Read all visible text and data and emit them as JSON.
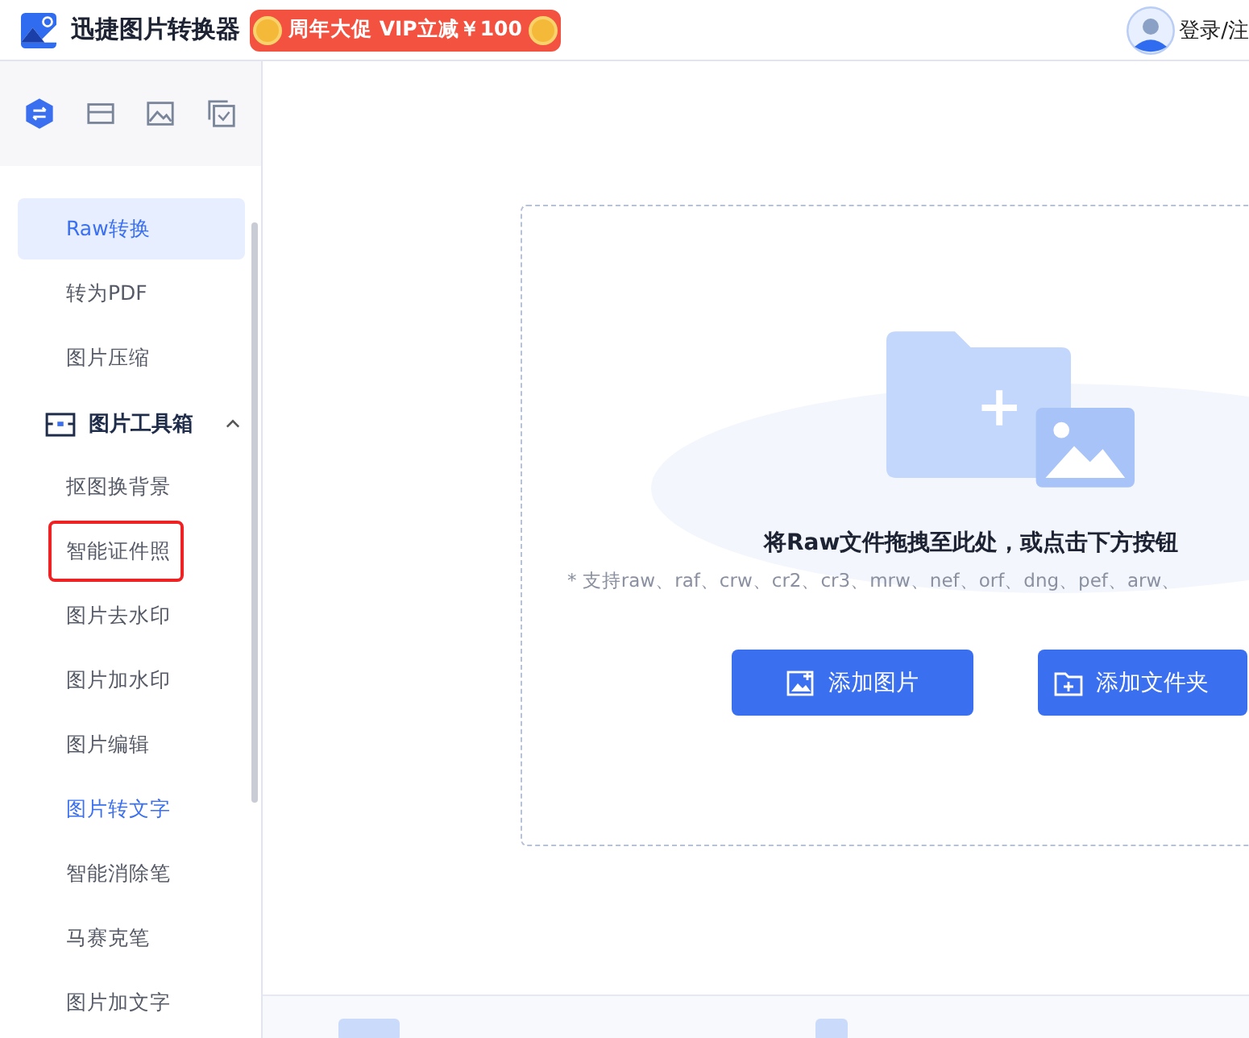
{
  "header": {
    "app_title": "迅捷图片转换器",
    "promo": "周年大促 VIP立减￥100",
    "login": "登录/注"
  },
  "sidebar": {
    "tabs": [
      {
        "selected": true
      },
      {
        "selected": false
      },
      {
        "selected": false
      },
      {
        "selected": false
      }
    ],
    "items": [
      {
        "kind": "item",
        "label": "Raw转换",
        "selected": true,
        "accent": false,
        "outlined": false
      },
      {
        "kind": "item",
        "label": "转为PDF",
        "selected": false,
        "accent": false,
        "outlined": false
      },
      {
        "kind": "item",
        "label": "图片压缩",
        "selected": false,
        "accent": false,
        "outlined": false
      },
      {
        "kind": "group",
        "label": "图片工具箱",
        "expanded": true
      },
      {
        "kind": "item",
        "label": "抠图换背景",
        "selected": false,
        "accent": false,
        "outlined": false
      },
      {
        "kind": "item",
        "label": "智能证件照",
        "selected": false,
        "accent": false,
        "outlined": true
      },
      {
        "kind": "item",
        "label": "图片去水印",
        "selected": false,
        "accent": false,
        "outlined": false
      },
      {
        "kind": "item",
        "label": "图片加水印",
        "selected": false,
        "accent": false,
        "outlined": false
      },
      {
        "kind": "item",
        "label": "图片编辑",
        "selected": false,
        "accent": false,
        "outlined": false
      },
      {
        "kind": "item",
        "label": "图片转文字",
        "selected": false,
        "accent": true,
        "outlined": false
      },
      {
        "kind": "item",
        "label": "智能消除笔",
        "selected": false,
        "accent": false,
        "outlined": false
      },
      {
        "kind": "item",
        "label": "马赛克笔",
        "selected": false,
        "accent": false,
        "outlined": false
      },
      {
        "kind": "item",
        "label": "图片加文字",
        "selected": false,
        "accent": false,
        "outlined": false
      }
    ]
  },
  "dropzone": {
    "title": "将Raw文件拖拽至此处，或点击下方按钮",
    "hint": "* 支持raw、raf、crw、cr2、cr3、mrw、nef、orf、dng、pef、arw、",
    "buttons": [
      {
        "kind": "image",
        "label": "添加图片"
      },
      {
        "kind": "folder",
        "label": "添加文件夹"
      }
    ]
  }
}
